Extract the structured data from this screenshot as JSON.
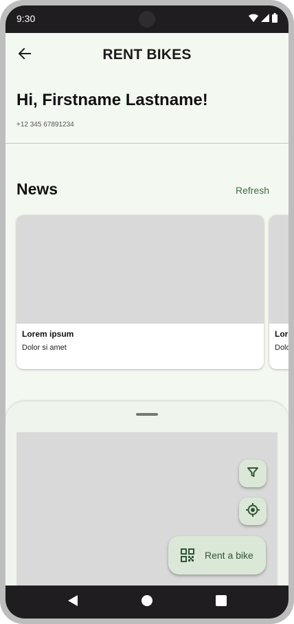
{
  "status_bar": {
    "time": "9:30",
    "icons": [
      "wifi-icon",
      "signal-icon",
      "battery-icon"
    ]
  },
  "app_bar": {
    "title": "RENT BIKES",
    "back_icon": "arrow-back-icon"
  },
  "profile": {
    "greeting": "Hi, Firstname Lastname!",
    "phone": "+12 345 67891234"
  },
  "news": {
    "title": "News",
    "refresh_label": "Refresh",
    "items": [
      {
        "title": "Lorem ipsum",
        "subtitle": "Dolor si amet"
      },
      {
        "title": "Lorem ipsum",
        "subtitle": "Dolor si amet"
      }
    ]
  },
  "map_sheet": {
    "filter_icon": "filter-icon",
    "location_icon": "my-location-icon",
    "rent_button_label": "Rent a bike",
    "rent_button_icon": "qr-code-icon"
  },
  "nav_bar": {
    "icons": [
      "nav-back-icon",
      "nav-home-icon",
      "nav-recents-icon"
    ]
  },
  "colors": {
    "accent": "#3e6b44",
    "background": "#f3f8f0",
    "fab_container": "#dbe7d7",
    "placeholder": "#d9d9d9",
    "system_bar": "#1f1d20"
  }
}
